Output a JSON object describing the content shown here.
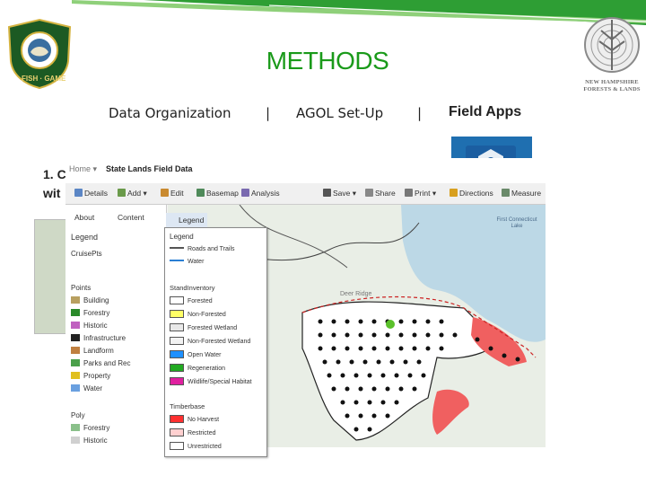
{
  "slide": {
    "title": "METHODS",
    "nav": {
      "item1": "Data Organization",
      "sep": "|",
      "item2": "AGOL Set-Up",
      "item3": "Field Apps"
    },
    "body_line1": "1. C",
    "body_line2": "wit",
    "logo_right_text": "NEW HAMPSHIRE FORESTS & LANDS",
    "logo_left_text": "FISH · GAME"
  },
  "app": {
    "home": "Home ▾",
    "title": "State Lands Field Data",
    "toolbar": [
      "Details",
      "Add ▾",
      "Edit",
      "Basemap",
      "Analysis",
      "Save ▾",
      "Share",
      "Print ▾",
      "Directions",
      "Measure"
    ],
    "left_tabs": [
      "About",
      "Content",
      "Legend"
    ],
    "left_legend_heading": "Legend",
    "left_items": [
      "CruisePts",
      "Points",
      "Building",
      "Forestry",
      "Historic",
      "Infrastructure",
      "Landform",
      "Parks and Rec",
      "Property",
      "Water",
      "Poly",
      "Forestry",
      "Historic"
    ],
    "map_labels": {
      "lake": "First Connecticut Lake",
      "ridge": "Deer Ridge"
    }
  },
  "legend_popup": {
    "title": "Legend",
    "lines": [
      {
        "label": "Roads and Trails",
        "color": "#555555"
      },
      {
        "label": "Water",
        "color": "#2a7fd4"
      }
    ],
    "stand_heading": "StandInventory",
    "stand": [
      {
        "label": "Forested",
        "color": "#ffffff"
      },
      {
        "label": "Non-Forested",
        "color": "#ffff66"
      },
      {
        "label": "Forested Wetland",
        "color": "#e8e8e8"
      },
      {
        "label": "Non-Forested Wetland",
        "color": "#f2f2f2"
      },
      {
        "label": "Open Water",
        "color": "#1e90ff"
      },
      {
        "label": "Regeneration",
        "color": "#22aa22"
      },
      {
        "label": "Wildlife/Special Habitat",
        "color": "#e020a0"
      }
    ],
    "timber_heading": "Timberbase",
    "timber": [
      {
        "label": "No Harvest",
        "color": "#ff3030"
      },
      {
        "label": "Restricted",
        "color": "#ffd0d0"
      },
      {
        "label": "Unrestricted",
        "color": "#ffffff"
      }
    ]
  }
}
